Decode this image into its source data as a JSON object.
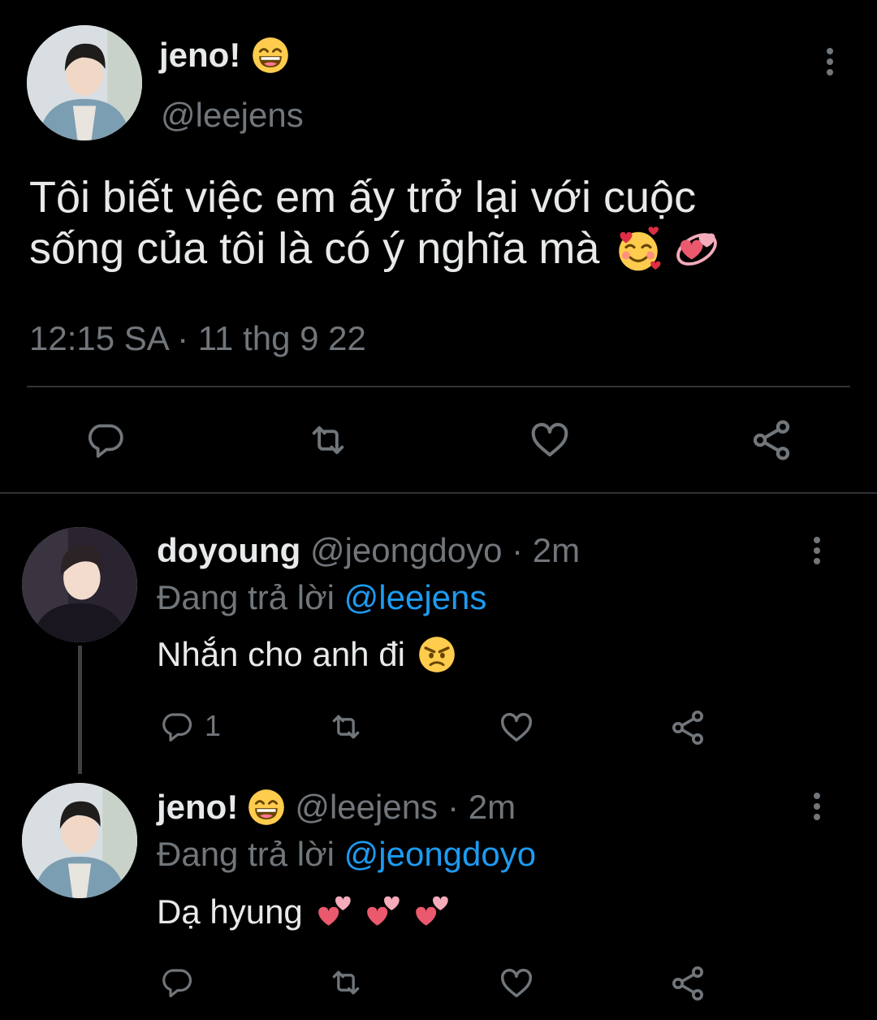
{
  "main_tweet": {
    "display_name": "jeno!",
    "name_emoji": "grinning-face",
    "handle": "@leejens",
    "text": "Tôi biết việc em ấy trở lại với cuộc sống của tôi là có ý nghĩa mà",
    "text_line1": "Tôi biết việc em ấy trở lại với cuộc",
    "text_line2": "sống của tôi là có ý nghĩa mà",
    "text_emojis": [
      "smiling-face-with-hearts",
      "revolving-hearts"
    ],
    "timestamp": "12:15 SA · 11 thg 9 22",
    "actions": [
      "reply-icon",
      "retweet-icon",
      "like-icon",
      "share-icon"
    ]
  },
  "replies": [
    {
      "display_name": "doyoung",
      "handle": "@jeongdoyo",
      "time": "· 2m",
      "replying_prefix": "Đang trả lời",
      "replying_to": "@leejens",
      "text": "Nhắn cho anh đi",
      "text_emojis": [
        "angry-face"
      ],
      "reply_count": "1"
    },
    {
      "display_name": "jeno!",
      "name_emoji": "grinning-face",
      "handle": "@leejens",
      "time": "· 2m",
      "replying_prefix": "Đang trả lời",
      "replying_to": "@jeongdoyo",
      "text": "Dạ hyung",
      "text_emojis": [
        "two-hearts",
        "two-hearts",
        "two-hearts"
      ],
      "reply_count": ""
    }
  ],
  "colors": {
    "background": "#000000",
    "text": "#e7e9ea",
    "muted": "#71767b",
    "link": "#1d9bf0",
    "divider": "#2f3336"
  }
}
